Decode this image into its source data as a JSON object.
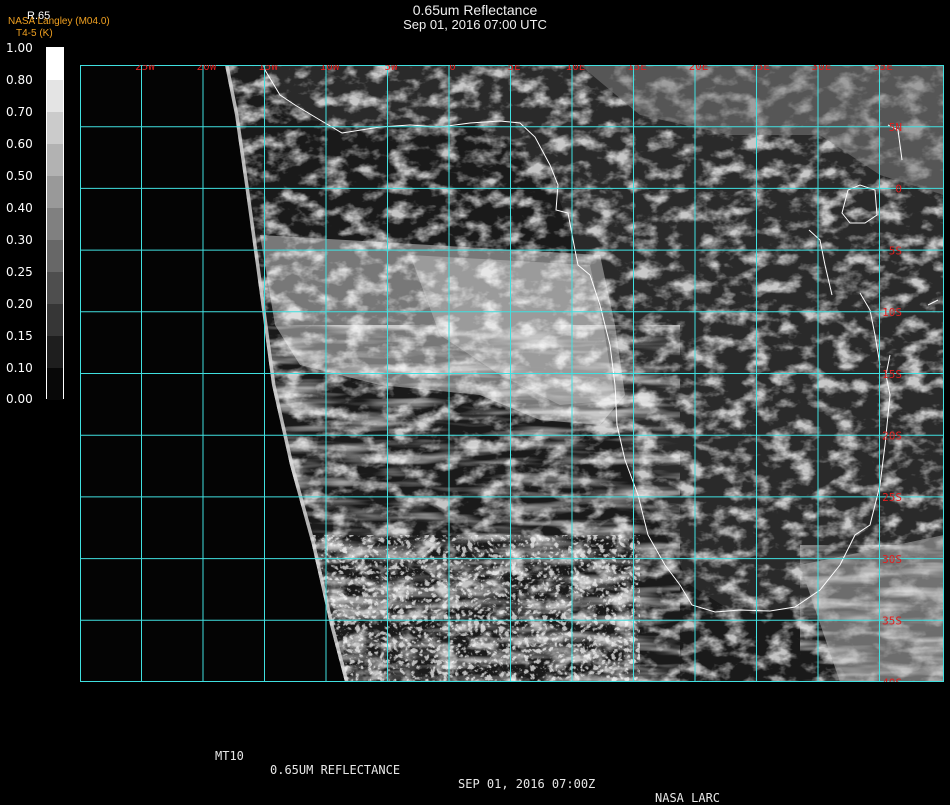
{
  "header": {
    "title": "0.65um Reflectance",
    "subtitle": "Sep 01, 2016 07:00 UTC",
    "credit_line1": "NASA Langley (M04.0)",
    "credit_line2": "T4-5 (K)"
  },
  "colorbar": {
    "label": "R.65",
    "ticks": [
      "1.00",
      "0.80",
      "0.70",
      "0.60",
      "0.50",
      "0.40",
      "0.30",
      "0.25",
      "0.20",
      "0.15",
      "0.10",
      "0.00"
    ]
  },
  "map": {
    "lon_labels": [
      "25W",
      "20W",
      "15W",
      "10W",
      "5W",
      "0",
      "5E",
      "10E",
      "15E",
      "20E",
      "25E",
      "30E",
      "35E"
    ],
    "lat_labels": [
      "5N",
      "0",
      "5S",
      "10S",
      "15S",
      "20S",
      "25S",
      "30S",
      "35S",
      "40S"
    ],
    "grid_color": "#40e0e0",
    "label_color": "#e02020",
    "coast_color": "#ffffff"
  },
  "footer": {
    "product": "MT10",
    "field": "0.65UM REFLECTANCE",
    "datetime": "SEP 01, 2016 07:00Z",
    "source": "NASA LARC"
  }
}
